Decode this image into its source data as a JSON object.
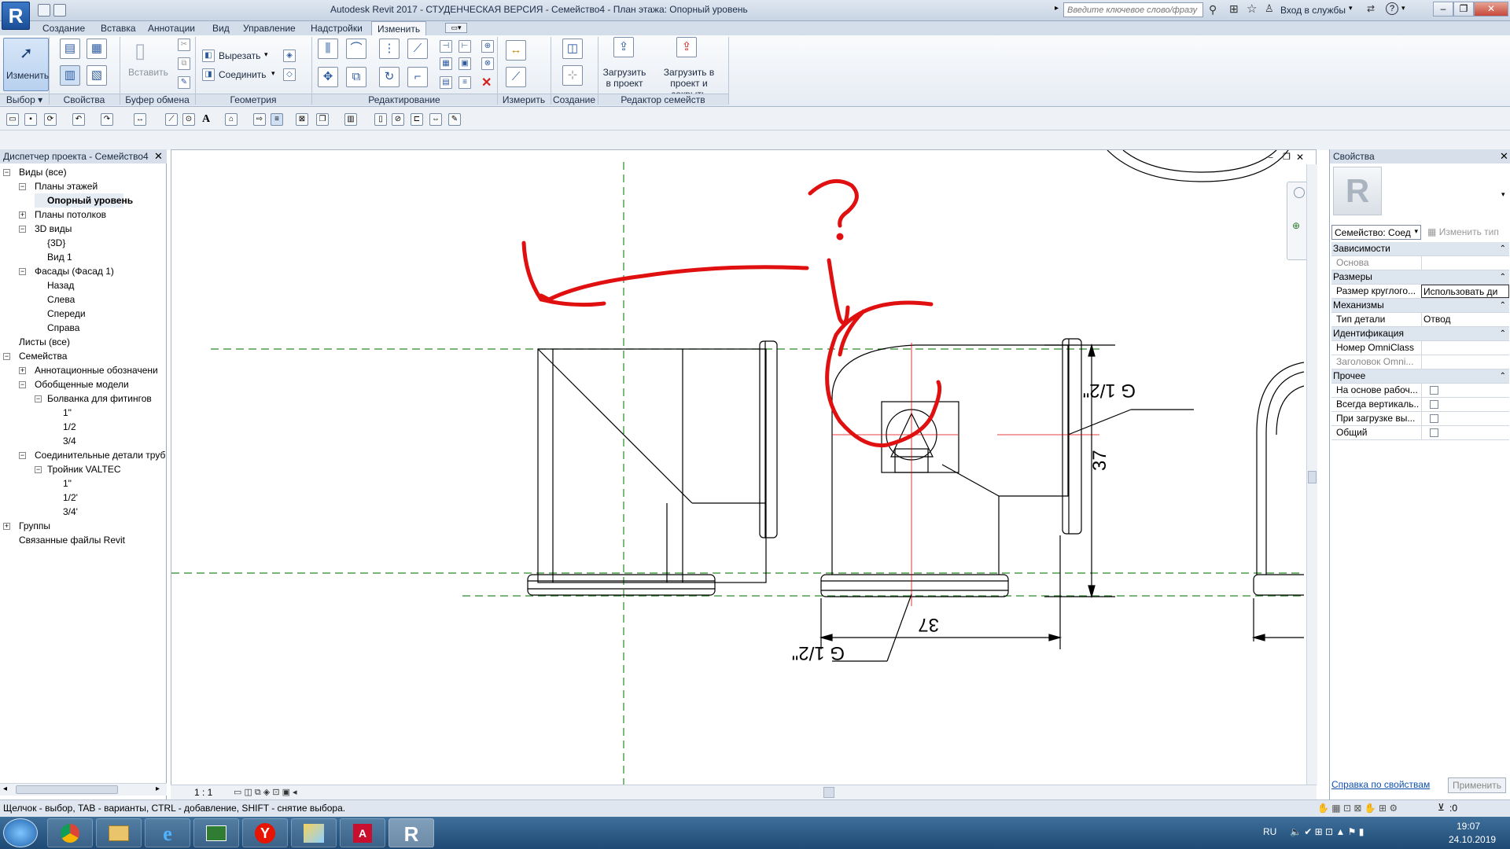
{
  "window": {
    "title": "Autodesk Revit 2017 - СТУДЕНЧЕСКАЯ ВЕРСИЯ -    Семейство4 - План этажа: Опорный уровень",
    "search_placeholder": "Введите ключевое слово/фразу",
    "login_label": "Вход в службы"
  },
  "tabs": [
    "Создание",
    "Вставка",
    "Аннотации",
    "Вид",
    "Управление",
    "Надстройки",
    "Изменить"
  ],
  "ribbon": {
    "modify_label": "Изменить",
    "paste_label": "Вставить",
    "cut_label": "Вырезать",
    "join_label": "Соединить",
    "load_project_label": "Загрузить в проект",
    "load_close_label": "Загрузить в проект и закрыть",
    "panels": [
      "Выбор",
      "Свойства",
      "Буфер обмена",
      "Геометрия",
      "Редактирование",
      "Измерить",
      "Создание",
      "Редактор семейств"
    ]
  },
  "project_browser": {
    "title": "Диспетчер проекта - Семейство4",
    "items": [
      {
        "label": "Виды (все)",
        "level": 0,
        "toggle": "-"
      },
      {
        "label": "Планы этажей",
        "level": 1,
        "toggle": "-"
      },
      {
        "label": "Опорный уровень",
        "level": 2,
        "toggle": "",
        "selected": true
      },
      {
        "label": "Планы потолков",
        "level": 1,
        "toggle": "+"
      },
      {
        "label": "3D виды",
        "level": 1,
        "toggle": "-"
      },
      {
        "label": "{3D}",
        "level": 2,
        "toggle": ""
      },
      {
        "label": "Вид 1",
        "level": 2,
        "toggle": ""
      },
      {
        "label": "Фасады (Фасад 1)",
        "level": 1,
        "toggle": "-"
      },
      {
        "label": "Назад",
        "level": 2,
        "toggle": ""
      },
      {
        "label": "Слева",
        "level": 2,
        "toggle": ""
      },
      {
        "label": "Спереди",
        "level": 2,
        "toggle": ""
      },
      {
        "label": "Справа",
        "level": 2,
        "toggle": ""
      },
      {
        "label": "Листы (все)",
        "level": 0,
        "toggle": ""
      },
      {
        "label": "Семейства",
        "level": 0,
        "toggle": "-"
      },
      {
        "label": "Аннотационные обозначени",
        "level": 1,
        "toggle": "+"
      },
      {
        "label": "Обобщенные модели",
        "level": 1,
        "toggle": "-"
      },
      {
        "label": "Болванка для фитингов",
        "level": 2,
        "toggle": "-"
      },
      {
        "label": "1\"",
        "level": 3,
        "toggle": ""
      },
      {
        "label": "1/2",
        "level": 3,
        "toggle": ""
      },
      {
        "label": "3/4",
        "level": 3,
        "toggle": ""
      },
      {
        "label": "Соединительные детали труб",
        "level": 1,
        "toggle": "-"
      },
      {
        "label": "Тройник VALTEC",
        "level": 2,
        "toggle": "-"
      },
      {
        "label": "1\"",
        "level": 3,
        "toggle": ""
      },
      {
        "label": "1/2'",
        "level": 3,
        "toggle": ""
      },
      {
        "label": "3/4'",
        "level": 3,
        "toggle": ""
      },
      {
        "label": "Группы",
        "level": 0,
        "toggle": "+"
      },
      {
        "label": "Связанные файлы Revit",
        "level": 0,
        "toggle": ""
      }
    ]
  },
  "drawing": {
    "dim_thread_1": "G 1/2\"",
    "dim_thread_2": "G 1/2\"",
    "dim_height": "37",
    "dim_width": "37",
    "annotation_question": "?"
  },
  "view_control": {
    "scale": "1 : 1"
  },
  "properties": {
    "title": "Свойства",
    "family_selector": "Семейство: Соед",
    "edit_type": "Изменить тип",
    "groups": [
      {
        "name": "Зависимости",
        "rows": [
          {
            "name": "Основа",
            "value": "",
            "greyed": true
          }
        ]
      },
      {
        "name": "Размеры",
        "rows": [
          {
            "name": "Размер круглого...",
            "value": "Использовать ди"
          }
        ]
      },
      {
        "name": "Механизмы",
        "rows": [
          {
            "name": "Тип детали",
            "value": "Отвод"
          }
        ]
      },
      {
        "name": "Идентификация",
        "rows": [
          {
            "name": "Номер OmniClass",
            "value": ""
          },
          {
            "name": "Заголовок Omni...",
            "value": "",
            "greyed": true
          }
        ]
      },
      {
        "name": "Прочее",
        "rows": [
          {
            "name": "На основе рабоч...",
            "check": true
          },
          {
            "name": "Всегда вертикаль...",
            "check": true
          },
          {
            "name": "При загрузке вы...",
            "check": true
          },
          {
            "name": "Общий",
            "check": true
          }
        ]
      }
    ],
    "help_link": "Справка по свойствам",
    "apply": "Применить"
  },
  "status": {
    "text": "Щелчок - выбор, TAB - варианты, CTRL - добавление, SHIFT - снятие выбора.",
    "filter_count": ":0"
  },
  "taskbar": {
    "lang": "RU",
    "time": "19:07",
    "date": "24.10.2019"
  }
}
